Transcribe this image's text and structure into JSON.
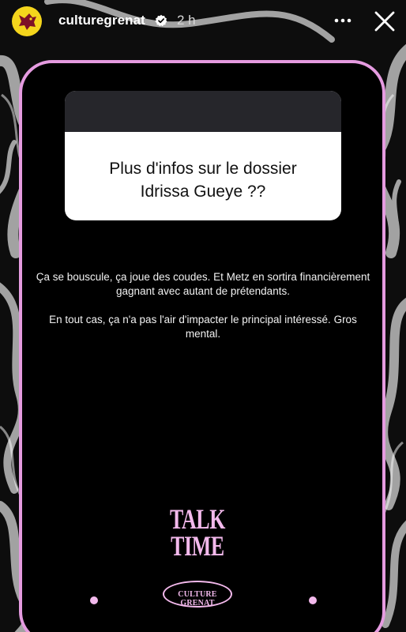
{
  "header": {
    "username": "culturegrenat",
    "time": "2 h",
    "avatar_color": "#f4d51c",
    "verified_icon": "verified-badge-icon",
    "more_icon": "more-options-icon",
    "close_icon": "close-icon"
  },
  "story": {
    "frame_color": "#e59be0",
    "question_lines": [
      "Plus d'infos sur le dossier",
      "Idrissa Gueye ??"
    ],
    "answer_paragraphs": [
      "Ça se bouscule, ça joue des coudes. Et Metz en sortira financièrement gagnant avec autant de prétendants.",
      "En tout cas, ça n'a pas l'air d'impacter le principal intéressé. Gros mental."
    ],
    "logo_line1": "TALK",
    "logo_line2": "TIME",
    "badge_text": "CULTURE GRENAT",
    "accent_color": "#f3b9ec"
  }
}
